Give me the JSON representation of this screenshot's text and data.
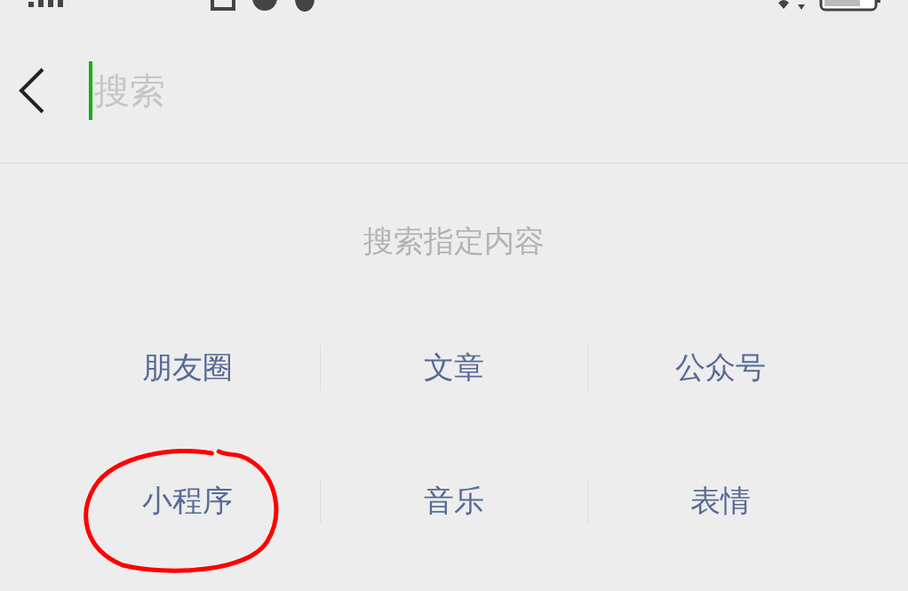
{
  "search": {
    "placeholder": "搜索"
  },
  "section_title": "搜索指定内容",
  "categories": [
    {
      "label": "朋友圈",
      "circled": false
    },
    {
      "label": "文章",
      "circled": false
    },
    {
      "label": "公众号",
      "circled": false
    },
    {
      "label": "小程序",
      "circled": true
    },
    {
      "label": "音乐",
      "circled": false
    },
    {
      "label": "表情",
      "circled": false
    }
  ]
}
